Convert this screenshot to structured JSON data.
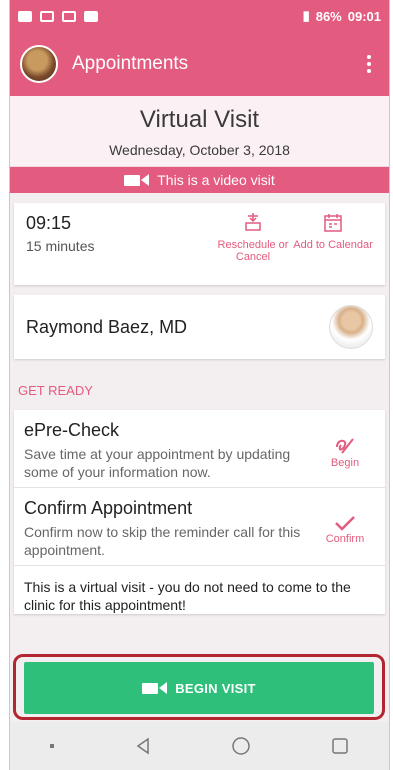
{
  "status_bar": {
    "battery": "86%",
    "time": "09:01"
  },
  "appbar": {
    "title": "Appointments"
  },
  "header": {
    "visit_type": "Virtual Visit",
    "date": "Wednesday, October 3, 2018"
  },
  "video_banner": {
    "text": "This is a video visit"
  },
  "appointment": {
    "time": "09:15",
    "duration": "15 minutes",
    "reschedule_label": "Reschedule or Cancel",
    "calendar_label": "Add to Calendar"
  },
  "doctor": {
    "name": "Raymond Baez, MD"
  },
  "section": {
    "get_ready": "GET READY"
  },
  "tasks": [
    {
      "title": "ePre-Check",
      "desc": "Save time at your appointment by updating some of your information now.",
      "action": "Begin"
    },
    {
      "title": "Confirm Appointment",
      "desc": "Confirm now to skip the reminder call for this appointment.",
      "action": "Confirm"
    }
  ],
  "notice": "This is a virtual visit - you do not need to come to the clinic for this appointment!",
  "begin_button": {
    "label": "BEGIN VISIT"
  },
  "colors": {
    "accent": "#e35b7e",
    "green": "#2ec07a",
    "highlight": "#b3262f"
  }
}
